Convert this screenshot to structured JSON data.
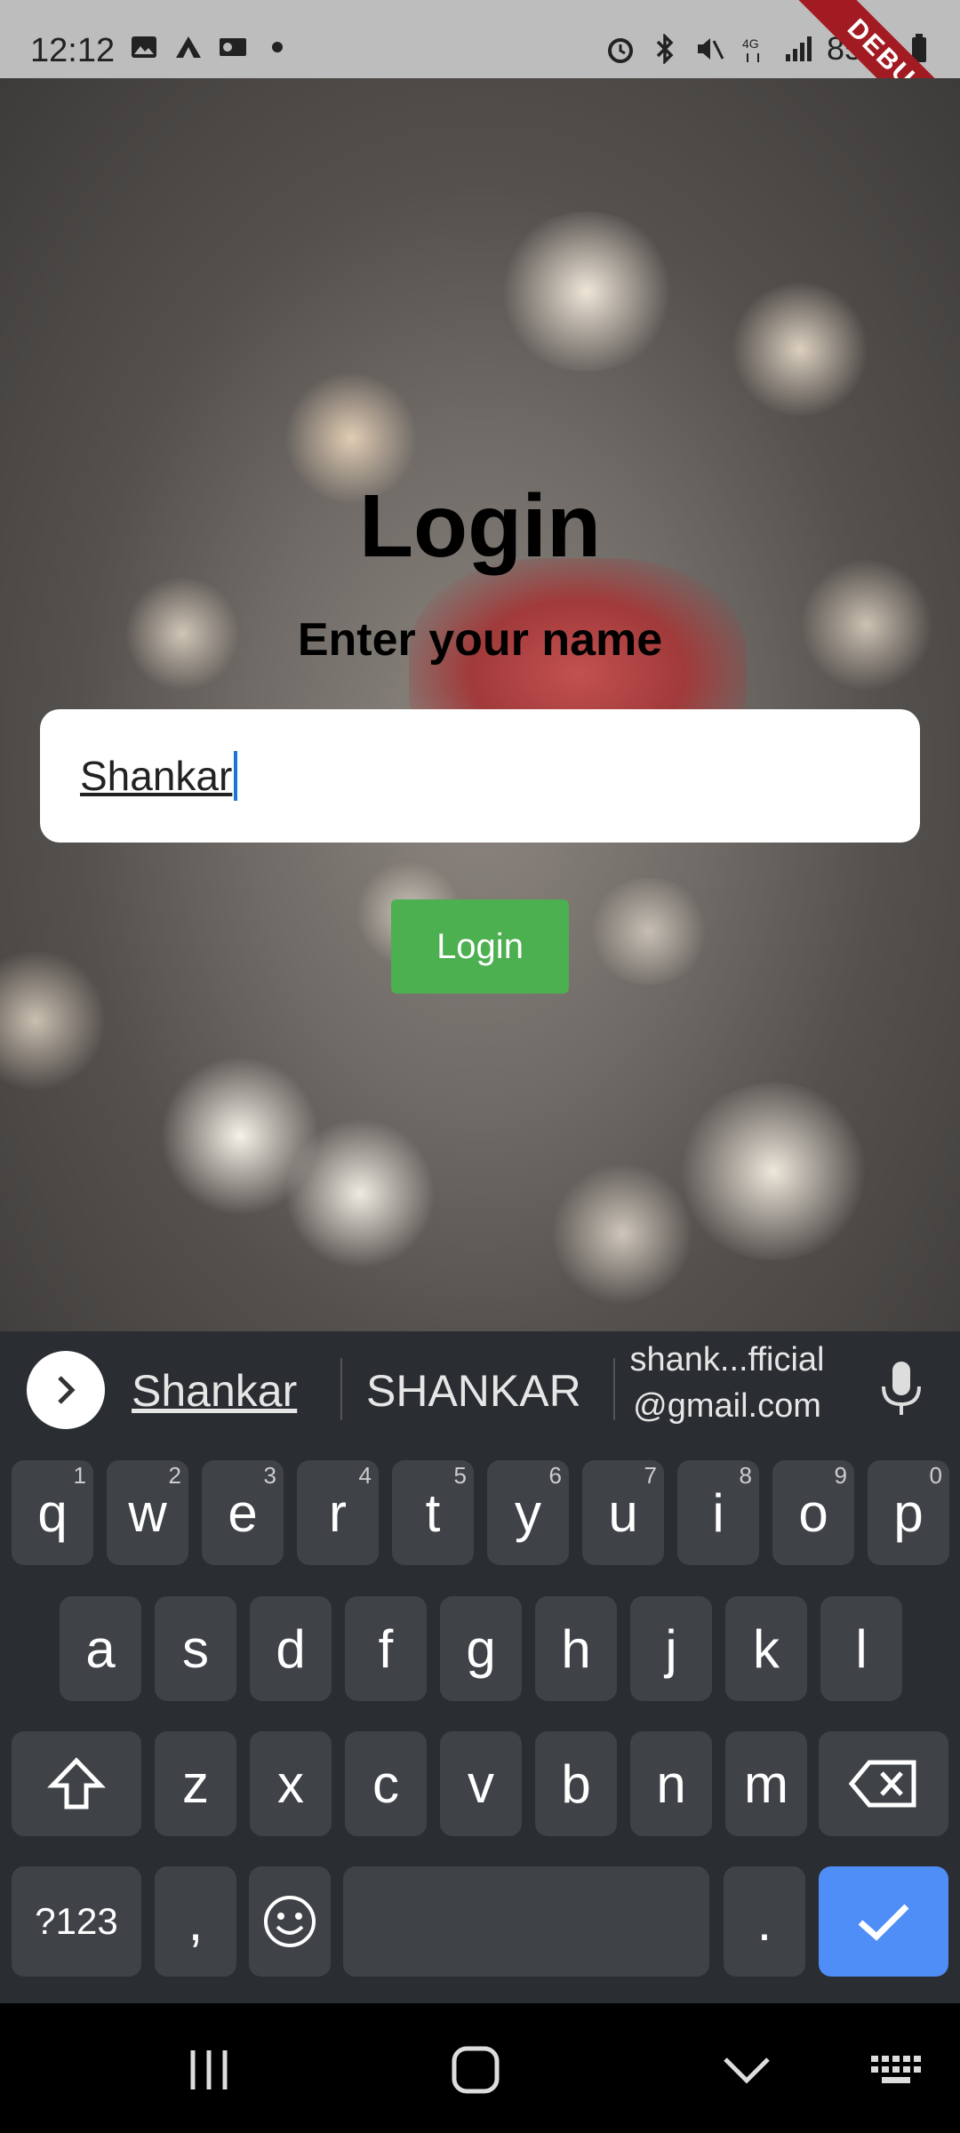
{
  "status": {
    "time": "12:12",
    "battery": "85%",
    "debug_label": "DEBUG"
  },
  "login": {
    "title": "Login",
    "subtitle": "Enter your name",
    "name_value": "Shankar",
    "button_label": "Login"
  },
  "keyboard": {
    "suggestions": [
      "Shankar",
      "SHANKAR",
      "shank...fficial\n@gmail.com"
    ],
    "row1": [
      {
        "k": "q",
        "h": "1"
      },
      {
        "k": "w",
        "h": "2"
      },
      {
        "k": "e",
        "h": "3"
      },
      {
        "k": "r",
        "h": "4"
      },
      {
        "k": "t",
        "h": "5"
      },
      {
        "k": "y",
        "h": "6"
      },
      {
        "k": "u",
        "h": "7"
      },
      {
        "k": "i",
        "h": "8"
      },
      {
        "k": "o",
        "h": "9"
      },
      {
        "k": "p",
        "h": "0"
      }
    ],
    "row2": [
      "a",
      "s",
      "d",
      "f",
      "g",
      "h",
      "j",
      "k",
      "l"
    ],
    "row3": [
      "z",
      "x",
      "c",
      "v",
      "b",
      "n",
      "m"
    ],
    "symbols_label": "?123",
    "comma": ",",
    "period": "."
  },
  "colors": {
    "login_button": "#4caf50",
    "enter_key": "#4f8ef7",
    "debug_ribbon": "#a31b22"
  }
}
